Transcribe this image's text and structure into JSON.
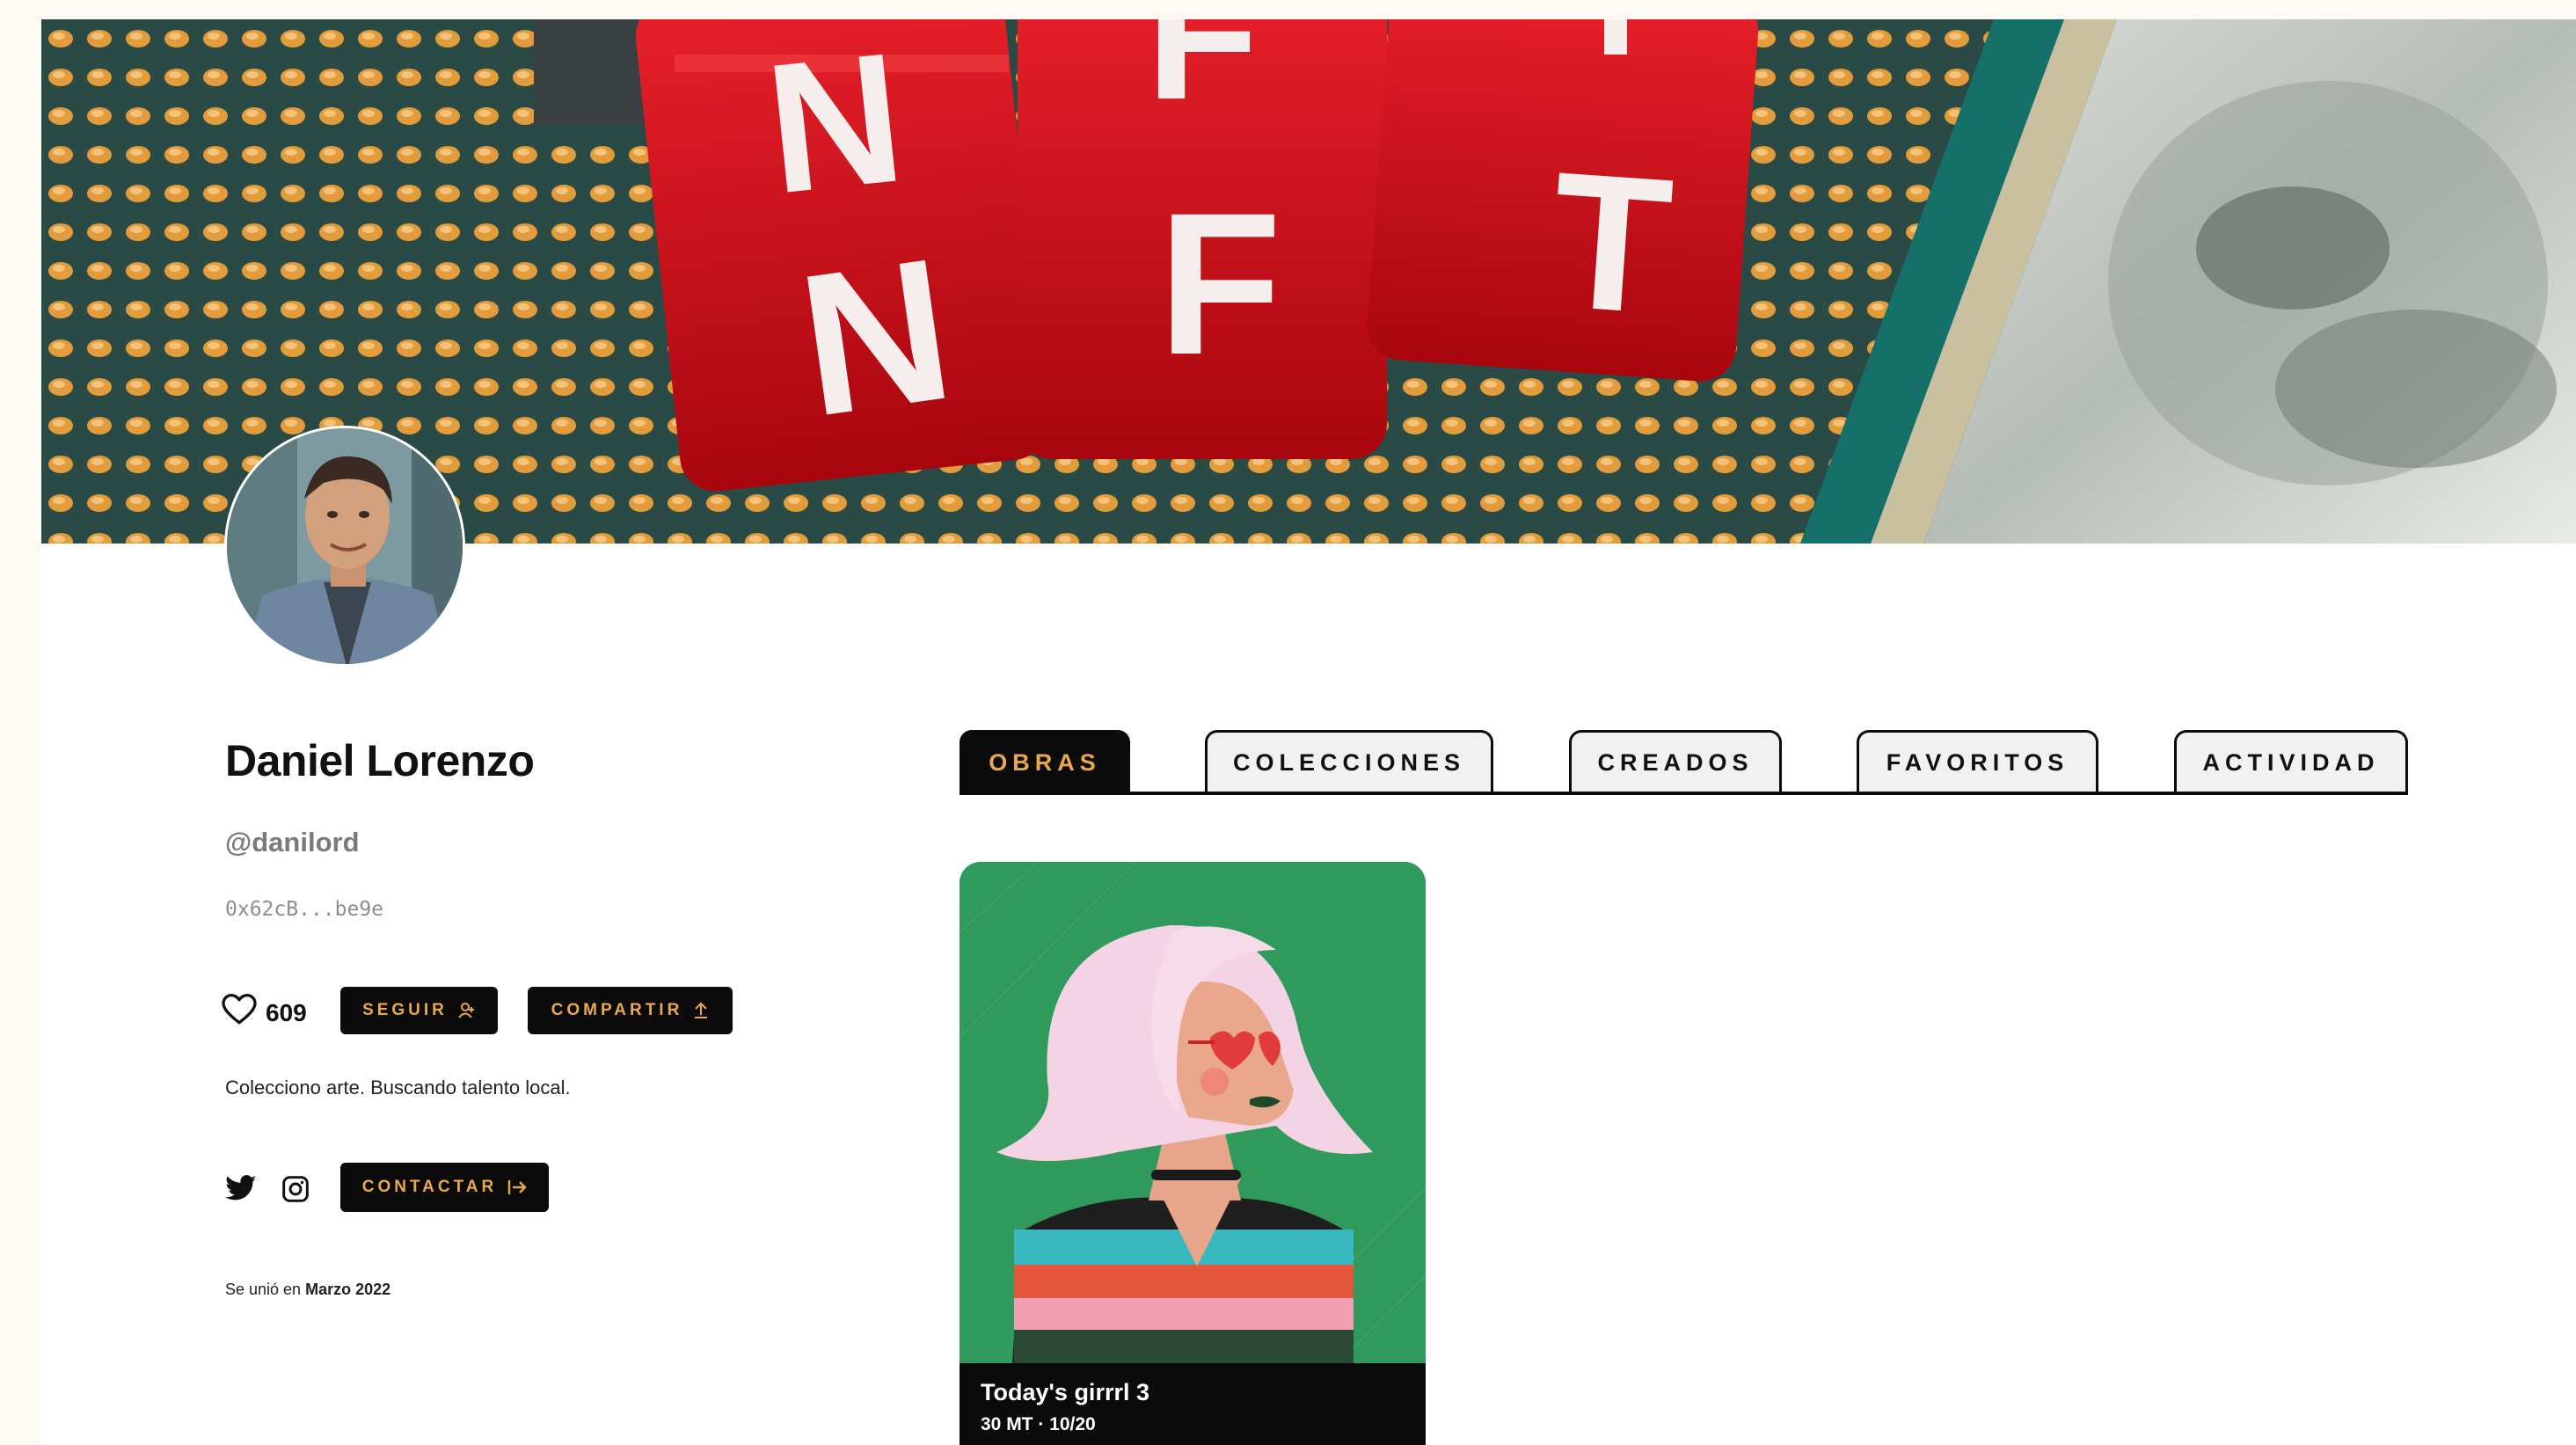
{
  "profile": {
    "name": "Daniel Lorenzo",
    "handle": "@danilord",
    "wallet": "0x62cB...be9e",
    "likes": "609",
    "bio": "Colecciono arte. Buscando talento local.",
    "joined_prefix": "Se unió en",
    "joined_date": "Marzo 2022"
  },
  "banner": {
    "cube_letters": [
      "N",
      "F",
      "T"
    ]
  },
  "buttons": {
    "follow": "SEGUIR",
    "share": "COMPARTIR",
    "contact": "CONTACTAR"
  },
  "tabs": [
    {
      "label": "OBRAS",
      "active": true
    },
    {
      "label": "COLECCIONES",
      "active": false
    },
    {
      "label": "CREADOS",
      "active": false
    },
    {
      "label": "FAVORITOS",
      "active": false
    },
    {
      "label": "ACTIVIDAD",
      "active": false
    }
  ],
  "artworks": [
    {
      "title": "Today's girrrl 3",
      "meta": "30 MT · 10/20"
    }
  ],
  "colors": {
    "accent": "#e9a94a",
    "dark": "#0b0b0b",
    "card_bg": "#2f9a5c"
  },
  "icons": [
    "heart-icon",
    "follow-user-icon",
    "share-upload-icon",
    "twitter-icon",
    "instagram-icon",
    "contact-exit-icon"
  ]
}
